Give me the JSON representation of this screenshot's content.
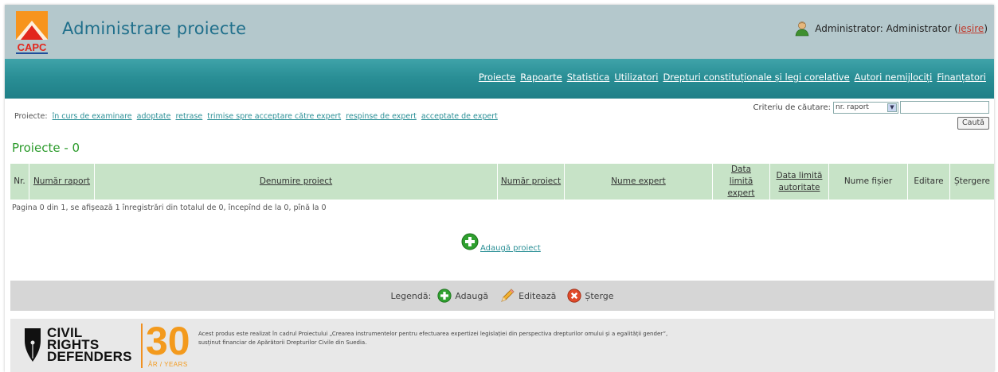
{
  "header": {
    "logo_text": "CAPC",
    "title": "Administrare proiecte",
    "user_label": "Administrator: Administrator (",
    "logout_label": "ieșire",
    "user_suffix": ")"
  },
  "nav": {
    "items": [
      "Proiecte",
      "Rapoarte",
      "Statistica",
      "Utilizatori",
      "Drepturi constituționale și legi corelative",
      "Autori nemijlociți",
      "Finanțatori"
    ]
  },
  "filters": {
    "label": "Proiecte:",
    "items": [
      "în curs de examinare",
      "adoptate",
      "retrase",
      "trimise spre acceptare către expert",
      "respinse de expert",
      "acceptate de expert"
    ]
  },
  "search": {
    "label": "Criteriu de căutare:",
    "selected": "nr. raport",
    "input_value": "",
    "button_label": "Caută"
  },
  "section_title": "Proiecte - 0",
  "table": {
    "columns": [
      {
        "label": "Nr.",
        "link": false
      },
      {
        "label": "Număr raport",
        "link": true
      },
      {
        "label": "Denumire proiect",
        "link": true
      },
      {
        "label": "Număr proiect",
        "link": true
      },
      {
        "label": "Nume expert",
        "link": true
      },
      {
        "label": "Data limită expert",
        "link": true
      },
      {
        "label": "Data limită autoritate",
        "link": true
      },
      {
        "label": "Nume fișier",
        "link": false
      },
      {
        "label": "Editare",
        "link": false
      },
      {
        "label": "Ștergere",
        "link": false
      }
    ],
    "pager_text": "Pagina 0 din 1, se afișează 1 înregistrări din totalul de 0, începînd de la 0, pînă la 0"
  },
  "add_project_label": "Adaugă proiect",
  "legend": {
    "label": "Legendă:",
    "add": "Adaugă",
    "edit": "Editează",
    "delete": "Șterge"
  },
  "footer": {
    "org_line1": "CIVIL",
    "org_line2": "RIGHTS",
    "org_line3": "DEFENDERS",
    "anniversary": "30",
    "years_label": "ÅR / YEARS",
    "text_line1": "Acest produs este realizat în cadrul Proiectului „Crearea instrumentelor pentru efectuarea expertizei legislației din perspectiva drepturilor omului și a egalității gender”,",
    "text_line2": "susținut financiar de Apărătorii Drepturilor Civile din Suedia."
  },
  "colors": {
    "header_bg": "#b4c8cc",
    "nav_bg": "#2a8f96",
    "title": "#1f6f8b",
    "section_title": "#2a9a2a",
    "table_header_bg": "#c7e3c7",
    "accent_orange": "#f39a1d"
  }
}
